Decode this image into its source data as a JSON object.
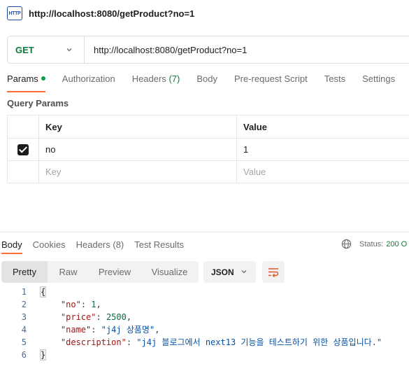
{
  "title_bar": {
    "icon_text": "HTTP",
    "title": "http://localhost:8080/getProduct?no=1"
  },
  "request": {
    "method": "GET",
    "url": "http://localhost:8080/getProduct?no=1"
  },
  "request_tabs": {
    "params": "Params",
    "authorization": "Authorization",
    "headers": "Headers",
    "headers_count": "(7)",
    "body": "Body",
    "pre_request_script": "Pre-request Script",
    "tests": "Tests",
    "settings": "Settings"
  },
  "query_params": {
    "title": "Query Params",
    "key_header": "Key",
    "value_header": "Value",
    "row": {
      "checked": true,
      "key": "no",
      "value": "1"
    },
    "key_placeholder": "Key",
    "value_placeholder": "Value"
  },
  "response_tabs": {
    "body": "Body",
    "cookies": "Cookies",
    "headers": "Headers (8)",
    "test_results": "Test Results"
  },
  "status": {
    "label": "Status:",
    "value": "200 O"
  },
  "view_modes": {
    "pretty": "Pretty",
    "raw": "Raw",
    "preview": "Preview",
    "visualize": "Visualize"
  },
  "format": "JSON",
  "response_body": {
    "line_numbers": [
      "1",
      "2",
      "3",
      "4",
      "5",
      "6"
    ],
    "open_brace": "{",
    "close_brace": "}",
    "no_key": "\"no\"",
    "no_value": "1",
    "price_key": "\"price\"",
    "price_value": "2500",
    "name_key": "\"name\"",
    "name_value": "\"j4j 상품명\"",
    "description_key": "\"description\"",
    "description_value": "\"j4j 블로그에서 next13 기능을 테스트하기 위한 상품입니다.\""
  },
  "colors": {
    "accent": "#ff6c37",
    "method_green": "#0b7a3e",
    "json_key": "#a31515",
    "json_string": "#0451a5"
  }
}
